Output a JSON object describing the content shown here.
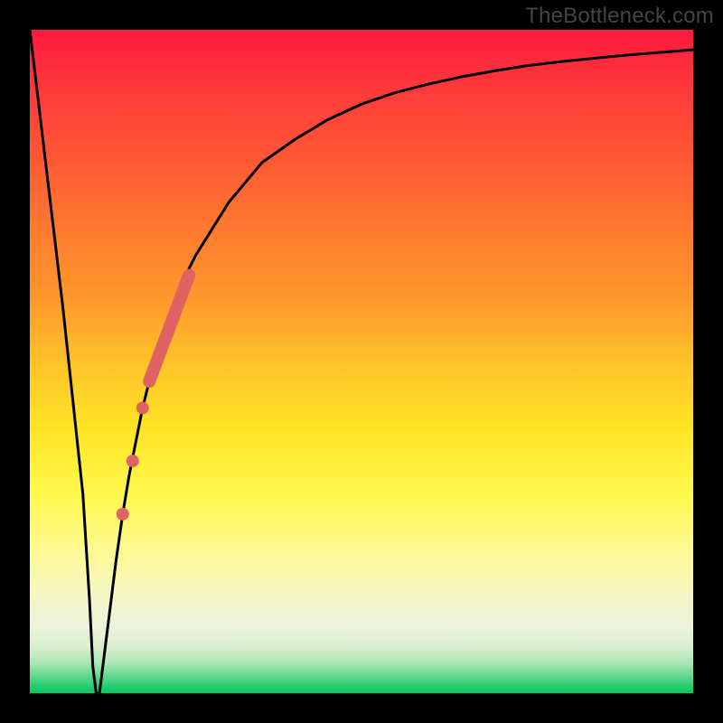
{
  "watermark": "TheBottleneck.com",
  "plot": {
    "outer_width": 800,
    "outer_height": 800,
    "inner_x": 33,
    "inner_y": 33,
    "inner_w": 734,
    "inner_h": 734
  },
  "gradient": {
    "stops": [
      {
        "offset": 0.0,
        "color": "#ff1a3f"
      },
      {
        "offset": 0.1,
        "color": "#ff3d3a"
      },
      {
        "offset": 0.2,
        "color": "#ff5a34"
      },
      {
        "offset": 0.3,
        "color": "#ff7a2f"
      },
      {
        "offset": 0.4,
        "color": "#ff962c"
      },
      {
        "offset": 0.5,
        "color": "#ffc229"
      },
      {
        "offset": 0.6,
        "color": "#ffe425"
      },
      {
        "offset": 0.7,
        "color": "#fff84d"
      },
      {
        "offset": 0.78,
        "color": "#fdf98e"
      },
      {
        "offset": 0.85,
        "color": "#f6f7c4"
      },
      {
        "offset": 0.9,
        "color": "#edf3db"
      },
      {
        "offset": 0.93,
        "color": "#d9efd0"
      },
      {
        "offset": 0.955,
        "color": "#a8e6b4"
      },
      {
        "offset": 0.975,
        "color": "#5fd88c"
      },
      {
        "offset": 0.99,
        "color": "#23cd6e"
      },
      {
        "offset": 1.0,
        "color": "#08c95f"
      }
    ]
  },
  "chart_data": {
    "type": "line",
    "title": "",
    "xlabel": "",
    "ylabel": "",
    "xlim": [
      0,
      100
    ],
    "ylim": [
      0,
      100
    ],
    "x": [
      0,
      5,
      8,
      9,
      9.5,
      10,
      10.5,
      11,
      12,
      13,
      14,
      15,
      17,
      19,
      21,
      23,
      25,
      30,
      35,
      40,
      45,
      50,
      55,
      60,
      65,
      70,
      75,
      80,
      85,
      90,
      95,
      100
    ],
    "y": [
      100,
      58,
      30,
      14,
      4,
      0,
      0,
      4,
      12,
      20,
      27,
      33,
      43,
      51,
      57,
      62,
      66,
      74,
      80,
      83.5,
      86.5,
      88.8,
      90.5,
      91.8,
      92.9,
      93.8,
      94.6,
      95.2,
      95.7,
      96.2,
      96.6,
      97
    ],
    "note": "x is relative position across the plotting area (0=left edge, 100=right edge). y is percentage of vertical span (0=bottom of chart, 100=top of chart). The curve drops sharply from top-left into a narrow V-shaped trough near x≈10 that touches the green band at the bottom, then rises and asymptotically approaches ~97% on the right.",
    "markers": {
      "note": "Salmon-colored dots and a thick line segment lie ON the rising curve in its lower half.",
      "dots": [
        {
          "x": 14.0,
          "y": 27
        },
        {
          "x": 15.5,
          "y": 35
        },
        {
          "x": 17.0,
          "y": 43
        }
      ],
      "thick_segment": {
        "x0": 18.0,
        "y0": 47,
        "x1": 24.0,
        "y1": 63
      },
      "color": "#e06361"
    }
  }
}
